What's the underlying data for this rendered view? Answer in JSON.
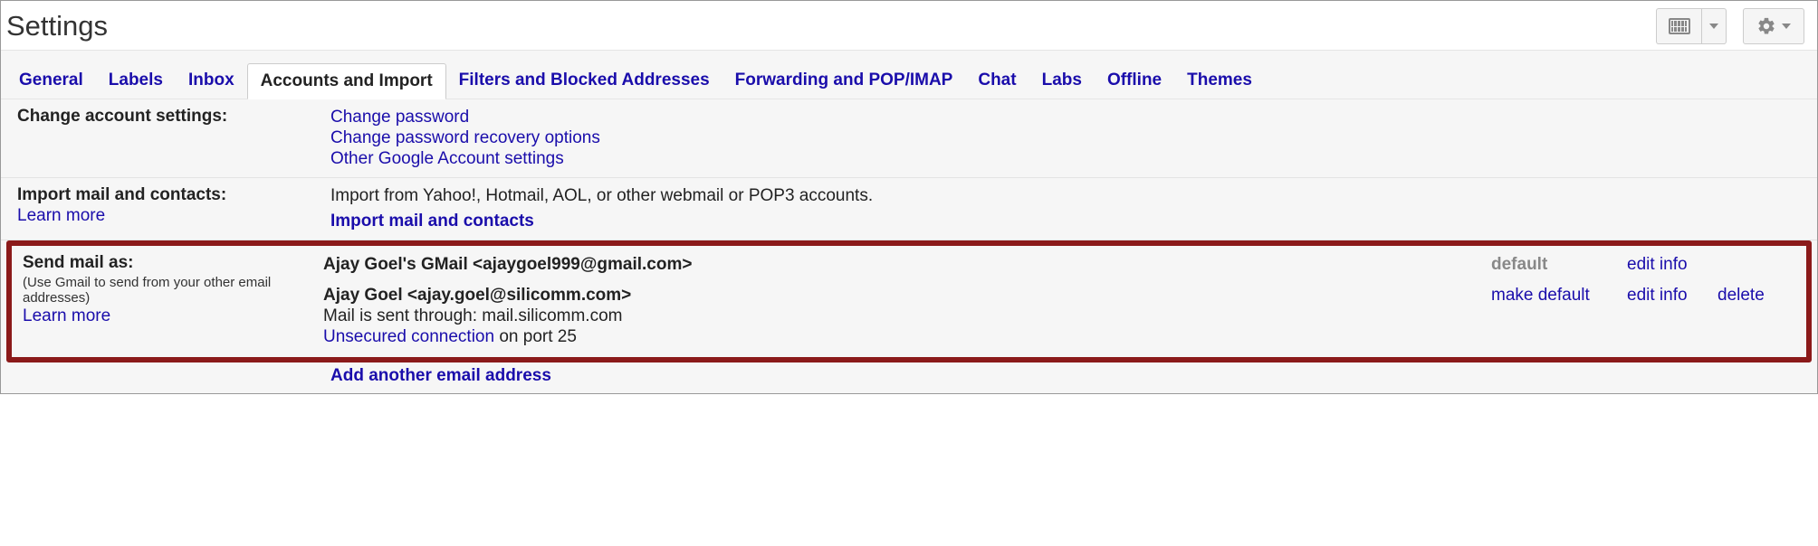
{
  "page_title": "Settings",
  "tabs": [
    {
      "id": "general",
      "label": "General"
    },
    {
      "id": "labels",
      "label": "Labels"
    },
    {
      "id": "inbox",
      "label": "Inbox"
    },
    {
      "id": "accounts",
      "label": "Accounts and Import"
    },
    {
      "id": "filters",
      "label": "Filters and Blocked Addresses"
    },
    {
      "id": "forwarding",
      "label": "Forwarding and POP/IMAP"
    },
    {
      "id": "chat",
      "label": "Chat"
    },
    {
      "id": "labs",
      "label": "Labs"
    },
    {
      "id": "offline",
      "label": "Offline"
    },
    {
      "id": "themes",
      "label": "Themes"
    }
  ],
  "change_account": {
    "title": "Change account settings:",
    "links": {
      "change_password": "Change password",
      "recovery": "Change password recovery options",
      "other": "Other Google Account settings"
    }
  },
  "import": {
    "title": "Import mail and contacts:",
    "learn_more": "Learn more",
    "desc": "Import from Yahoo!, Hotmail, AOL, or other webmail or POP3 accounts.",
    "action": "Import mail and contacts"
  },
  "send_mail_as": {
    "title": "Send mail as:",
    "subtitle": "(Use Gmail to send from your other email addresses)",
    "learn_more": "Learn more",
    "rows": [
      {
        "display": "Ajay Goel's GMail <ajaygoel999@gmail.com>",
        "default_label": "default",
        "edit": "edit info"
      },
      {
        "display": "Ajay Goel <ajay.goel@silicomm.com>",
        "mail_through": "Mail is sent through: mail.silicomm.com",
        "unsecured": "Unsecured connection",
        "port_text": " on port 25",
        "make_default": "make default",
        "edit": "edit info",
        "delete": "delete"
      }
    ],
    "add_another": "Add another email address"
  }
}
